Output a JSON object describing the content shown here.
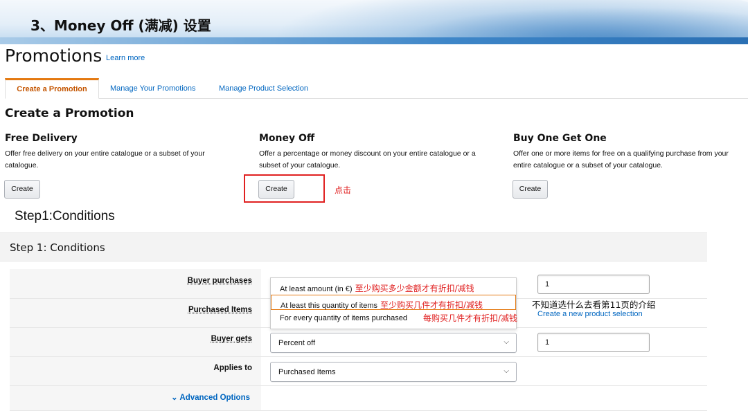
{
  "slide": {
    "title": "3、Money Off (满减) 设置"
  },
  "page": {
    "heading": "Promotions",
    "learn_more": "Learn more"
  },
  "tabs": [
    {
      "label": "Create a Promotion",
      "active": true
    },
    {
      "label": "Manage Your Promotions",
      "active": false
    },
    {
      "label": "Manage Product Selection",
      "active": false
    }
  ],
  "create_section": {
    "heading": "Create a Promotion",
    "cards": [
      {
        "title": "Free Delivery",
        "desc": "Offer free delivery on your entire catalogue or a subset of your catalogue.",
        "button": "Create"
      },
      {
        "title": "Money Off",
        "desc": "Offer a percentage or money discount on your entire catalogue or a subset of your catalogue.",
        "button": "Create"
      },
      {
        "title": "Buy One Get One",
        "desc": "Offer one or more items for free on a qualifying purchase from your entire catalogue or a subset of your catalogue.",
        "button": "Create"
      }
    ],
    "click_note": "点击"
  },
  "step_caption": "Step1:Conditions",
  "step1": {
    "header": "Step 1: Conditions",
    "rows": {
      "buyer_purchases": "Buyer purchases",
      "purchased_items": "Purchased Items",
      "buyer_gets": "Buyer gets",
      "applies_to": "Applies to"
    },
    "dropdown_options": [
      {
        "label": "At least amount (in €)",
        "note": "至少购买多少金额才有折扣/减钱"
      },
      {
        "label": "At least this quantity of items",
        "note": "至少购买几件才有折扣/减钱",
        "selected": true
      },
      {
        "label": "For every quantity of items purchased",
        "note": "每购买几件才有折扣/减钱"
      }
    ],
    "buyer_purchases_value": "1",
    "side_note": "不知道选什么去看第11页的介绍",
    "create_selection_link": "Create a new product selection",
    "buyer_gets_select": "Percent off",
    "buyer_gets_value": "1",
    "applies_to_select": "Purchased Items",
    "advanced_options": "Advanced Options"
  },
  "colors": {
    "link": "#0066c0",
    "accent_orange": "#e47911",
    "annotation_red": "#e02020"
  }
}
